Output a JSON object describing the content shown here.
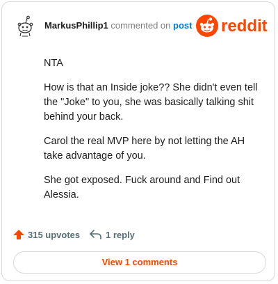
{
  "header": {
    "username": "MarkusPhillip1",
    "action_text": "commented on",
    "post_link": "post",
    "brand": "reddit",
    "brand_color": "#ff4500"
  },
  "comment": {
    "paragraphs": [
      "NTA",
      "How is that an Inside joke?? She didn't even tell the \"Joke\" to you, she was basically talking shit behind your back.",
      "Carol the real MVP here by not letting the AH take advantage of you.",
      "She got exposed. Fuck around and Find out Alessia."
    ]
  },
  "actions": {
    "upvotes_label": "315 upvotes",
    "reply_label": "1 reply",
    "upvote_icon": "upvote-arrow-icon",
    "reply_icon": "reply-arrow-icon"
  },
  "footer": {
    "view_comments_label": "View 1 comments"
  }
}
